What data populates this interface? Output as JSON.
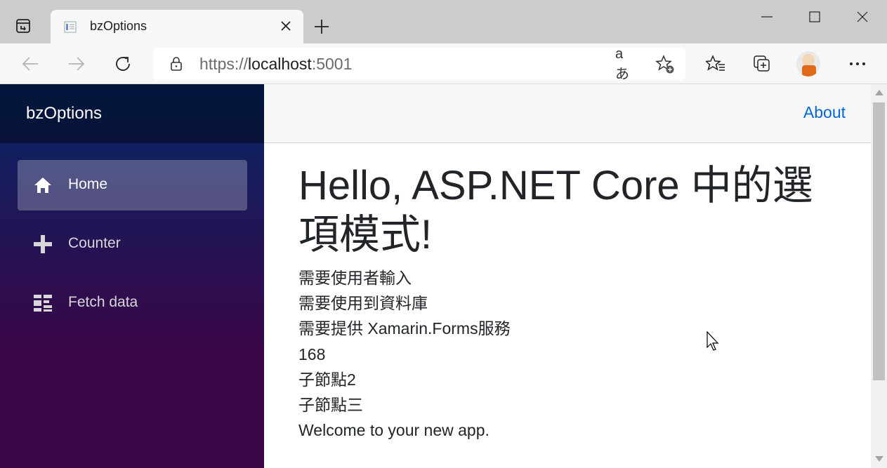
{
  "browser": {
    "tab": {
      "title": "bzOptions"
    },
    "address": {
      "scheme": "https://",
      "host": "localhost",
      "port": ":5001"
    },
    "read_aloud_label": "aあ"
  },
  "app": {
    "brand": "bzOptions",
    "nav": [
      {
        "label": "Home",
        "icon": "home-icon",
        "active": true
      },
      {
        "label": "Counter",
        "icon": "plus-icon",
        "active": false
      },
      {
        "label": "Fetch data",
        "icon": "list-icon",
        "active": false
      }
    ],
    "top_link": "About",
    "heading": "Hello, ASP.NET Core 中的選項模式!",
    "lines": [
      "需要使用者輸入",
      "需要使用到資料庫",
      "需要提供 Xamarin.Forms服務",
      "168",
      "子節點2",
      "子節點三",
      "Welcome to your new app."
    ]
  },
  "colors": {
    "tab_strip": "#cccccc",
    "toolbar": "#f7f7f7",
    "sidebar_top": "#052767",
    "sidebar_bottom": "#3a0647",
    "link": "#0366d6",
    "text": "#212529"
  }
}
